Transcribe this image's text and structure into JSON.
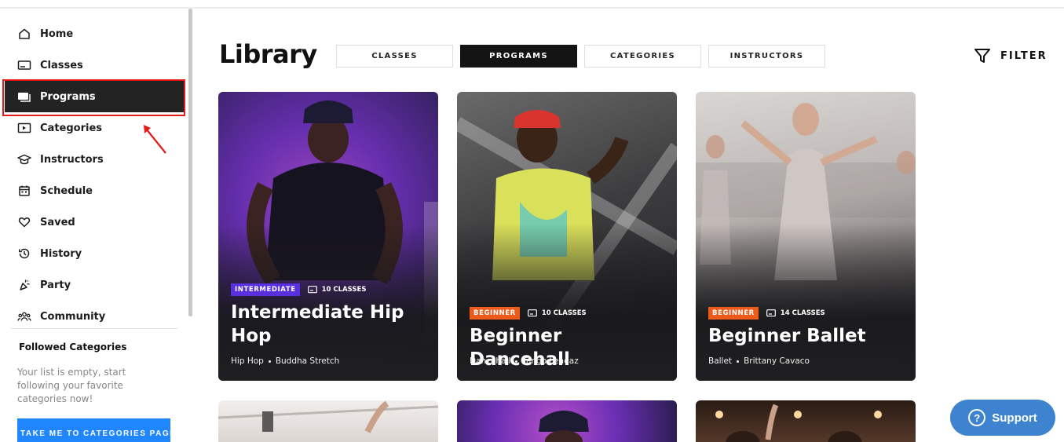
{
  "nav": {
    "items": [
      {
        "label": "Home",
        "icon": "home-icon"
      },
      {
        "label": "Classes",
        "icon": "classes-icon"
      },
      {
        "label": "Programs",
        "icon": "programs-icon"
      },
      {
        "label": "Categories",
        "icon": "categories-icon"
      },
      {
        "label": "Instructors",
        "icon": "instructors-icon"
      },
      {
        "label": "Schedule",
        "icon": "schedule-icon"
      },
      {
        "label": "Saved",
        "icon": "heart-icon"
      },
      {
        "label": "History",
        "icon": "history-icon"
      },
      {
        "label": "Party",
        "icon": "party-icon"
      },
      {
        "label": "Community",
        "icon": "community-icon"
      }
    ],
    "active": "Programs"
  },
  "followed": {
    "title": "Followed Categories",
    "empty_text": "Your list is empty, start following your favorite categories now!",
    "button_label": "TAKE ME TO CATEGORIES PAGE"
  },
  "main": {
    "title": "Library",
    "tabs": [
      "CLASSES",
      "PROGRAMS",
      "CATEGORIES",
      "INSTRUCTORS"
    ],
    "active_tab": "PROGRAMS",
    "filter_label": "FILTER"
  },
  "cards": [
    {
      "level": "INTERMEDIATE",
      "count": "10 CLASSES",
      "title": "Intermediate Hip Hop",
      "category": "Hip Hop",
      "instructor": "Buddha Stretch"
    },
    {
      "level": "BEGINNER",
      "count": "10 CLASSES",
      "title": "Beginner Dancehall",
      "category": "Dancehall",
      "instructor": "Tango Leadaz"
    },
    {
      "level": "BEGINNER",
      "count": "14 CLASSES",
      "title": "Beginner Ballet",
      "category": "Ballet",
      "instructor": "Brittany Cavaco"
    }
  ],
  "support": {
    "label": "Support"
  },
  "colors": {
    "active_nav": "#232324",
    "highlight": "#e41b1b",
    "intermediate_badge": "#5a2fe0",
    "beginner_badge": "#ec5a1c",
    "support_button": "#3d83cf",
    "categories_button": "#1f86ff"
  }
}
